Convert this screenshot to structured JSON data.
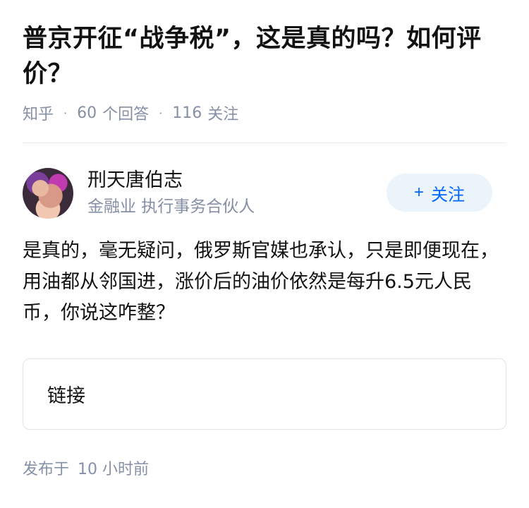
{
  "question": {
    "title": "普京开征“战争税”，这是真的吗？如何评价？",
    "source": "知乎",
    "answers_count": "60",
    "answers_label": "个回答",
    "followers_count": "116",
    "followers_label": "关注"
  },
  "answer": {
    "author_name": "刑天唐伯志",
    "author_headline": "金融业 执行事务合伙人",
    "follow_label": "关注",
    "follow_plus": "+",
    "content": "是真的，毫无疑问，俄罗斯官媒也承认，只是即便现在，用油都从邻国进，涨价后的油价依然是每升6.5元人民币，你说这咋整？",
    "link_label": "链接",
    "published_label": "发布于",
    "published_time": "10 小时前"
  },
  "colors": {
    "accent": "#0066ff",
    "meta": "#8590a6",
    "follow_bg": "#ebf3fb"
  }
}
